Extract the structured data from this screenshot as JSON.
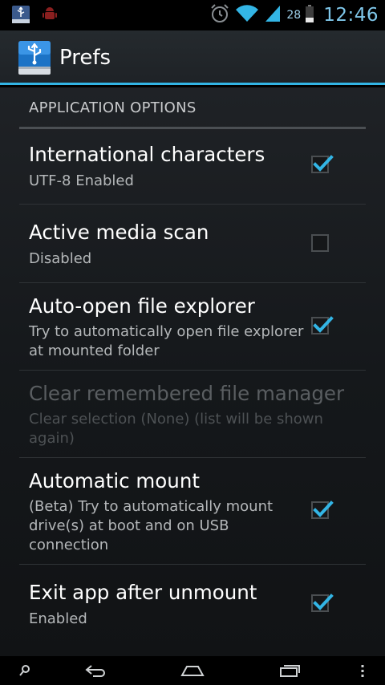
{
  "status_bar": {
    "battery_level": "28",
    "time": "12:46",
    "icons": [
      "usb-app-notification-icon",
      "android-debug-icon",
      "alarm-icon",
      "wifi-icon",
      "signal-icon",
      "battery-icon"
    ]
  },
  "action_bar": {
    "title": "Prefs",
    "icon": "usb-drive-icon",
    "accent_color": "#33b5e5"
  },
  "section": {
    "header": "APPLICATION OPTIONS"
  },
  "prefs": [
    {
      "title": "International characters",
      "summary": "UTF-8 Enabled",
      "checked": true,
      "enabled": true
    },
    {
      "title": "Active media scan",
      "summary": "Disabled",
      "checked": false,
      "enabled": true
    },
    {
      "title": "Auto-open file explorer",
      "summary": "Try to automatically open file explorer at mounted folder",
      "checked": true,
      "enabled": true
    },
    {
      "title": "Clear remembered file manager",
      "summary": "Clear selection (None) (list will be shown again)",
      "enabled": false
    },
    {
      "title": "Automatic mount",
      "summary": "(Beta) Try to automatically mount drive(s) at boot and on USB connection",
      "checked": true,
      "enabled": true
    },
    {
      "title": "Exit app after unmount",
      "summary": "Enabled",
      "checked": true,
      "enabled": true
    }
  ],
  "nav_bar": {
    "icons": [
      "search-icon",
      "back-icon",
      "home-icon",
      "recent-apps-icon",
      "overflow-menu-icon"
    ]
  }
}
